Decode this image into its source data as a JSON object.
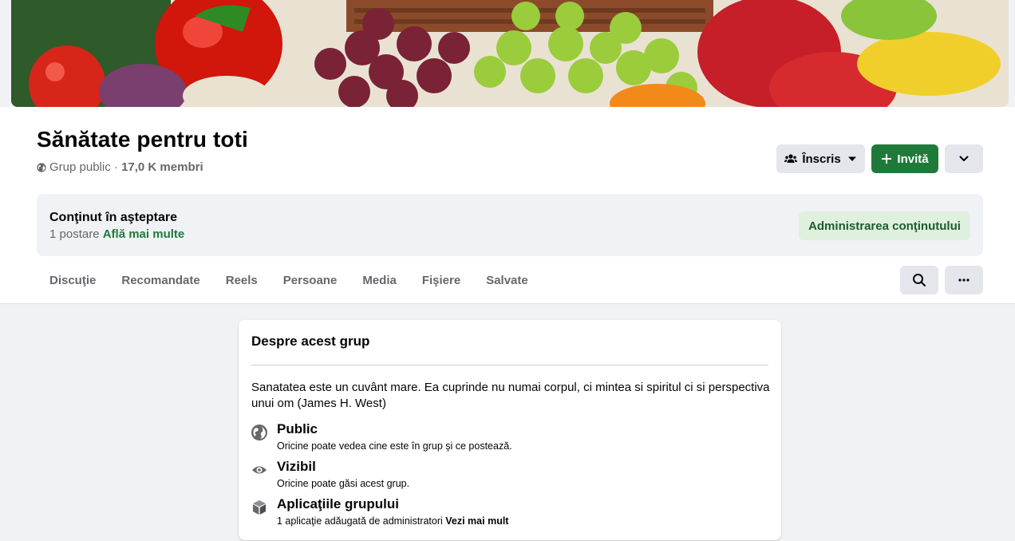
{
  "group": {
    "name": "Sănătate pentru toti",
    "privacy": "Grup public",
    "separator": " · ",
    "members": "17,0 K membri"
  },
  "actions": {
    "joined_label": "Înscris",
    "invite_label": "Invită",
    "accent_color": "#1f7a3a"
  },
  "pending": {
    "title": "Conţinut în aşteptare",
    "count_text": "1 postare",
    "learn_more": "Află mai multe",
    "manage_label": "Administrarea conţinutului"
  },
  "tabs": [
    {
      "label": "Discuţie"
    },
    {
      "label": "Recomandate"
    },
    {
      "label": "Reels"
    },
    {
      "label": "Persoane"
    },
    {
      "label": "Media"
    },
    {
      "label": "Fişiere"
    },
    {
      "label": "Salvate"
    }
  ],
  "about": {
    "title": "Despre acest grup",
    "description": "Sanatatea este un cuvânt mare. Ea cuprinde nu numai corpul, ci mintea si spiritul ci si perspectiva unui om (James H. West)",
    "items": [
      {
        "icon": "globe-icon",
        "title": "Public",
        "subtitle": "Oricine poate vedea cine este în grup şi ce postează.",
        "link": ""
      },
      {
        "icon": "eye-icon",
        "title": "Vizibil",
        "subtitle": "Oricine poate găsi acest grup.",
        "link": ""
      },
      {
        "icon": "cube-icon",
        "title": "Aplicaţiile grupului",
        "subtitle": "1 aplicaţie adăugată de administratori",
        "link": "Vezi mai mult"
      }
    ]
  }
}
